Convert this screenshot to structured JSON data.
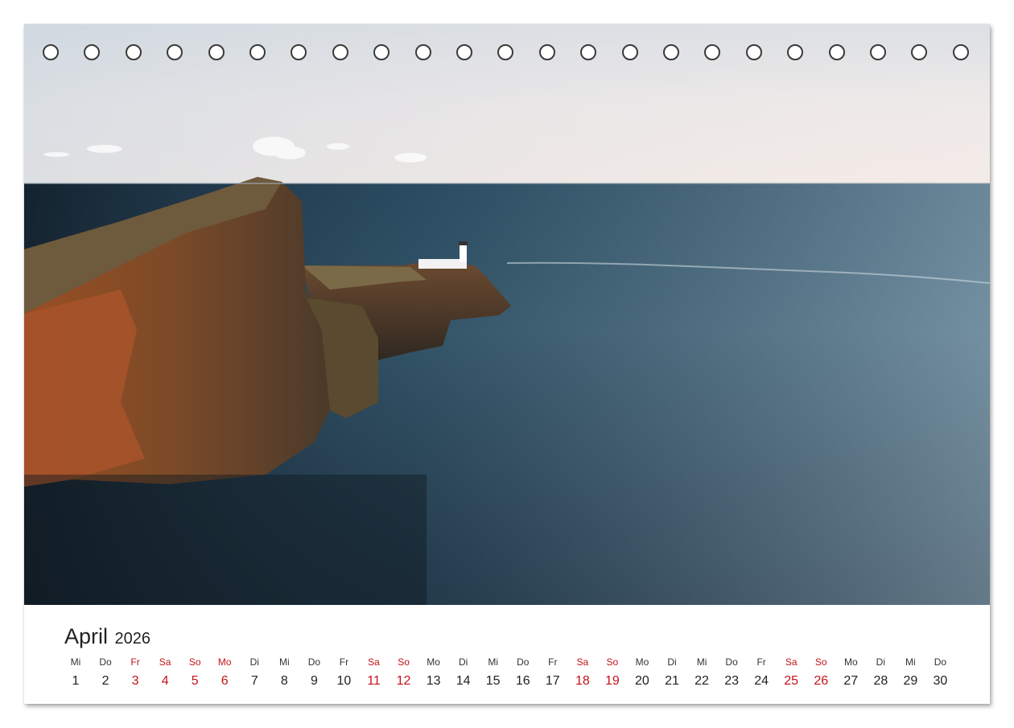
{
  "calendar": {
    "month": "April",
    "year": "2026",
    "weekend_color": "#c4121a",
    "days": [
      {
        "weekday": "Mi",
        "day": "1",
        "weekend": false
      },
      {
        "weekday": "Do",
        "day": "2",
        "weekend": false
      },
      {
        "weekday": "Fr",
        "day": "3",
        "weekend": true
      },
      {
        "weekday": "Sa",
        "day": "4",
        "weekend": true
      },
      {
        "weekday": "So",
        "day": "5",
        "weekend": true
      },
      {
        "weekday": "Mo",
        "day": "6",
        "weekend": true
      },
      {
        "weekday": "Di",
        "day": "7",
        "weekend": false
      },
      {
        "weekday": "Mi",
        "day": "8",
        "weekend": false
      },
      {
        "weekday": "Do",
        "day": "9",
        "weekend": false
      },
      {
        "weekday": "Fr",
        "day": "10",
        "weekend": false
      },
      {
        "weekday": "Sa",
        "day": "11",
        "weekend": true
      },
      {
        "weekday": "So",
        "day": "12",
        "weekend": true
      },
      {
        "weekday": "Mo",
        "day": "13",
        "weekend": false
      },
      {
        "weekday": "Di",
        "day": "14",
        "weekend": false
      },
      {
        "weekday": "Mi",
        "day": "15",
        "weekend": false
      },
      {
        "weekday": "Do",
        "day": "16",
        "weekend": false
      },
      {
        "weekday": "Fr",
        "day": "17",
        "weekend": false
      },
      {
        "weekday": "Sa",
        "day": "18",
        "weekend": true
      },
      {
        "weekday": "So",
        "day": "19",
        "weekend": true
      },
      {
        "weekday": "Mo",
        "day": "20",
        "weekend": false
      },
      {
        "weekday": "Di",
        "day": "21",
        "weekend": false
      },
      {
        "weekday": "Mi",
        "day": "22",
        "weekend": false
      },
      {
        "weekday": "Do",
        "day": "23",
        "weekend": false
      },
      {
        "weekday": "Fr",
        "day": "24",
        "weekend": false
      },
      {
        "weekday": "Sa",
        "day": "25",
        "weekend": true
      },
      {
        "weekday": "So",
        "day": "26",
        "weekend": true
      },
      {
        "weekday": "Mo",
        "day": "27",
        "weekend": false
      },
      {
        "weekday": "Di",
        "day": "28",
        "weekend": false
      },
      {
        "weekday": "Mi",
        "day": "29",
        "weekend": false
      },
      {
        "weekday": "Do",
        "day": "30",
        "weekend": false
      }
    ]
  }
}
